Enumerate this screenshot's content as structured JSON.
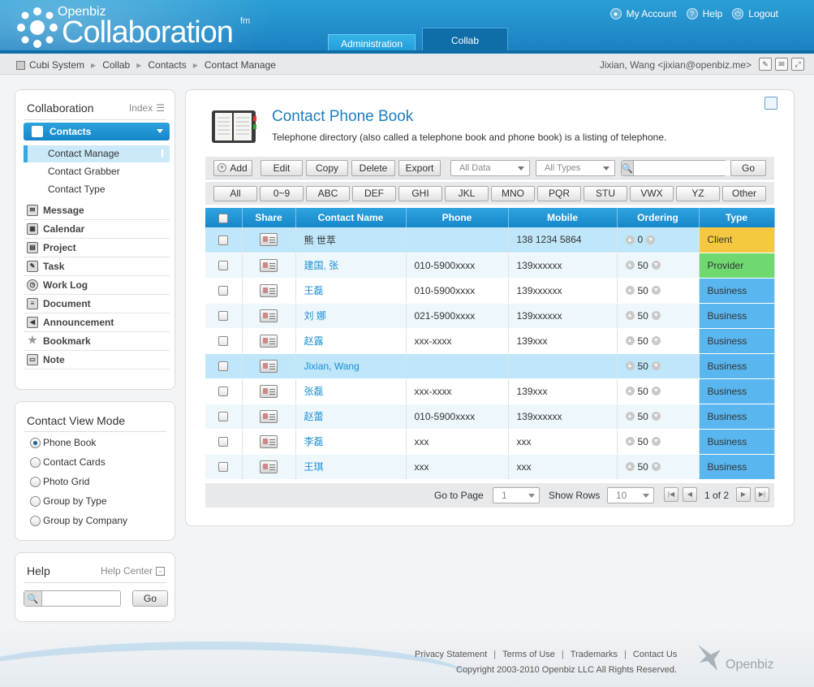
{
  "header": {
    "brand_small": "Openbiz",
    "brand_big": "Collaboration",
    "brand_tm": "fm",
    "links": [
      {
        "label": "My Account",
        "icon": "user-icon"
      },
      {
        "label": "Help",
        "icon": "help-icon"
      },
      {
        "label": "Logout",
        "icon": "power-icon"
      }
    ],
    "tabs": [
      {
        "label": "Administration"
      },
      {
        "label": "Collab"
      }
    ]
  },
  "breadcrumb": {
    "items": [
      "Cubi System",
      "Collab",
      "Contacts",
      "Contact Manage"
    ],
    "user": "Jixian, Wang <jixian@openbiz.me>"
  },
  "sidebar": {
    "title": "Collaboration",
    "index_label": "Index",
    "section": "Contacts",
    "sub_items": [
      "Contact Manage",
      "Contact Grabber",
      "Contact Type"
    ],
    "modules": [
      {
        "label": "Message",
        "icon": "message-icon"
      },
      {
        "label": "Calendar",
        "icon": "calendar-icon"
      },
      {
        "label": "Project",
        "icon": "project-icon"
      },
      {
        "label": "Task",
        "icon": "task-icon"
      },
      {
        "label": "Work Log",
        "icon": "clock-icon"
      },
      {
        "label": "Document",
        "icon": "document-icon"
      },
      {
        "label": "Announcement",
        "icon": "speaker-icon"
      },
      {
        "label": "Bookmark",
        "icon": "star-icon"
      },
      {
        "label": "Note",
        "icon": "note-icon"
      }
    ]
  },
  "view_mode": {
    "title": "Contact View Mode",
    "options": [
      "Phone Book",
      "Contact Cards",
      "Photo Grid",
      "Group by Type",
      "Group by Company"
    ],
    "selected": "Phone Book"
  },
  "help": {
    "title": "Help",
    "center_label": "Help Center",
    "search_value": "",
    "go_label": "Go"
  },
  "main": {
    "title": "Contact Phone Book",
    "description": "Telephone directory (also called a telephone book and phone book) is a listing of telephone.",
    "toolbar": {
      "add": "Add",
      "edit": "Edit",
      "copy": "Copy",
      "delete": "Delete",
      "export": "Export",
      "filter_data": "All Data",
      "filter_types": "All Types",
      "search_value": "",
      "go": "Go"
    },
    "alpha": [
      "All",
      "0~9",
      "ABC",
      "DEF",
      "GHI",
      "JKL",
      "MNO",
      "PQR",
      "STU",
      "VWX",
      "YZ",
      "Other"
    ],
    "columns": [
      "Share",
      "Contact Name",
      "Phone",
      "Mobile",
      "Ordering",
      "Type"
    ],
    "rows": [
      {
        "name": "熊 世萃",
        "phone": "",
        "mobile": "138 1234 5864",
        "ordering": "0",
        "type": "Client",
        "type_color": "#f5c842",
        "selected": true
      },
      {
        "name": "建国, 张",
        "phone": "010-5900xxxx",
        "mobile": "139xxxxxx",
        "ordering": "50",
        "type": "Provider",
        "type_color": "#6fd96f"
      },
      {
        "name": "王磊",
        "phone": "010-5900xxxx",
        "mobile": "139xxxxxx",
        "ordering": "50",
        "type": "Business",
        "type_color": "#5ab6ef"
      },
      {
        "name": "刘 娜",
        "phone": "021-5900xxxx",
        "mobile": "139xxxxxx",
        "ordering": "50",
        "type": "Business",
        "type_color": "#5ab6ef"
      },
      {
        "name": "赵露",
        "phone": "xxx-xxxx",
        "mobile": "139xxx",
        "ordering": "50",
        "type": "Business",
        "type_color": "#5ab6ef"
      },
      {
        "name": "Jixian, Wang",
        "phone": "",
        "mobile": "",
        "ordering": "50",
        "type": "Business",
        "type_color": "#5ab6ef",
        "highlight": true
      },
      {
        "name": "张磊",
        "phone": "xxx-xxxx",
        "mobile": "139xxx",
        "ordering": "50",
        "type": "Business",
        "type_color": "#5ab6ef"
      },
      {
        "name": "赵蕾",
        "phone": "010-5900xxxx",
        "mobile": "139xxxxxx",
        "ordering": "50",
        "type": "Business",
        "type_color": "#5ab6ef"
      },
      {
        "name": "李磊",
        "phone": "xxx",
        "mobile": "xxx",
        "ordering": "50",
        "type": "Business",
        "type_color": "#5ab6ef"
      },
      {
        "name": "王琪",
        "phone": "xxx",
        "mobile": "xxx",
        "ordering": "50",
        "type": "Business",
        "type_color": "#5ab6ef"
      }
    ],
    "pager": {
      "goto_label": "Go to Page",
      "page_value": "1",
      "show_rows_label": "Show Rows",
      "rows_value": "10",
      "page_info": "1 of 2"
    }
  },
  "footer": {
    "links": [
      "Privacy Statement",
      "Terms of Use",
      "Trademarks",
      "Contact Us"
    ],
    "copyright": "Copyright 2003-2010 Openbiz LLC All Rights Reserved.",
    "logo_text": "Openbiz"
  }
}
